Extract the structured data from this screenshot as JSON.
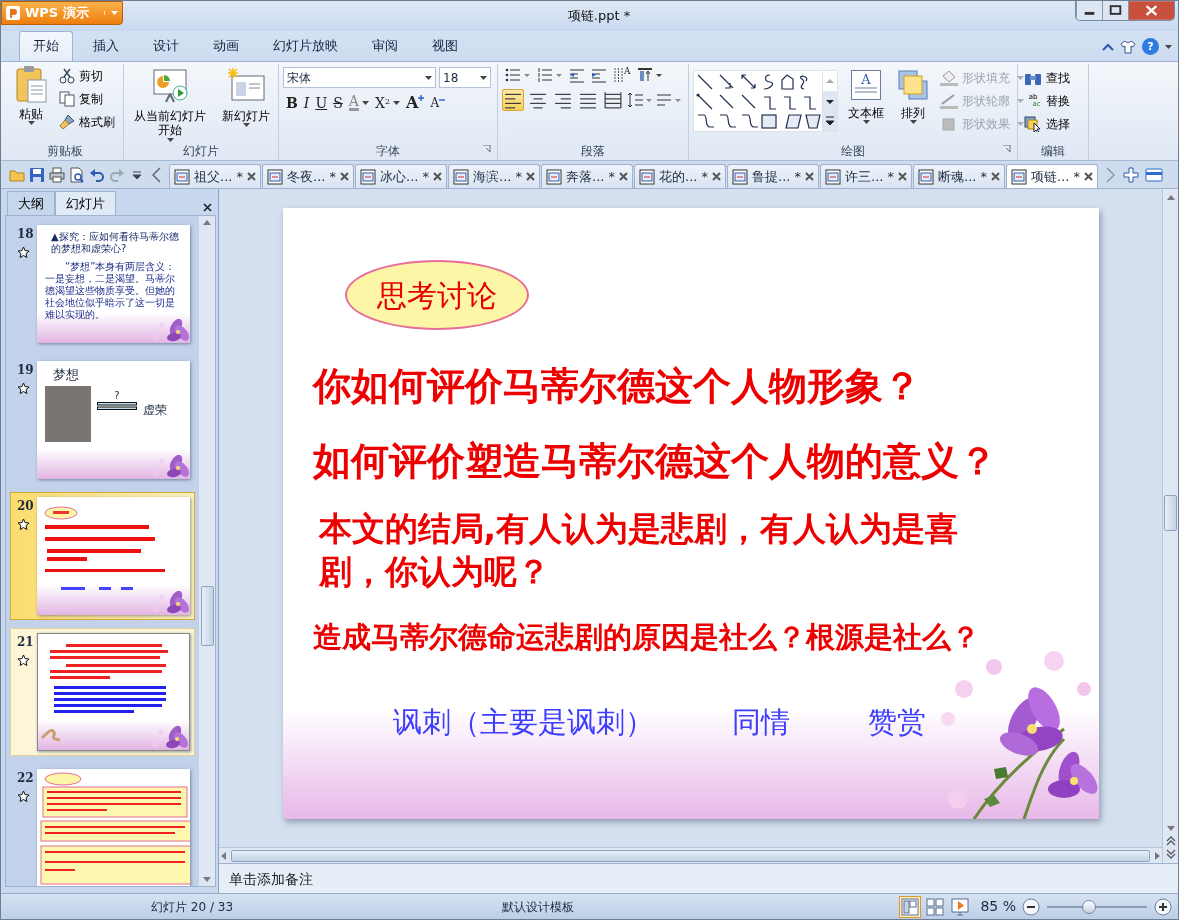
{
  "window": {
    "app_button": "WPS 演示",
    "title": "项链.ppt *"
  },
  "ribbon_tabs": [
    {
      "label": "开始",
      "selected": true
    },
    {
      "label": "插入",
      "selected": false
    },
    {
      "label": "设计",
      "selected": false
    },
    {
      "label": "动画",
      "selected": false
    },
    {
      "label": "幻灯片放映",
      "selected": false
    },
    {
      "label": "审阅",
      "selected": false
    },
    {
      "label": "视图",
      "selected": false
    }
  ],
  "ribbon_groups": [
    {
      "kind": "clipboard",
      "label": "剪贴板",
      "large": "粘贴",
      "small": [
        "剪切",
        "复制",
        "格式刷"
      ]
    },
    {
      "kind": "slides",
      "label": "幻灯片",
      "buttons": [
        {
          "lines": [
            "从当前幻灯片",
            "开始"
          ]
        },
        {
          "lines": [
            "新幻灯片"
          ]
        }
      ]
    },
    {
      "kind": "font",
      "label": "字体",
      "font": "宋体",
      "size": "18",
      "styles": [
        "B",
        "I",
        "U",
        "S"
      ],
      "font_color_glyph": "A",
      "superscript": "X$^{2}$",
      "grow": "A",
      "shrink": "A"
    },
    {
      "kind": "paragraph",
      "label": "段落",
      "direction": "A",
      "align": [
        {
          "selected": true
        },
        {
          "selected": false
        },
        {
          "selected": false
        },
        {
          "selected": false
        },
        {
          "selected": false
        }
      ]
    },
    {
      "kind": "drawing",
      "label": "绘图",
      "textbox_glyph": "A",
      "large": [
        "文本框",
        "排列"
      ],
      "shape_commands": [
        {
          "label": "形状填充",
          "disabled": true
        },
        {
          "label": "形状轮廓",
          "disabled": true
        },
        {
          "label": "形状效果",
          "disabled": true
        }
      ]
    },
    {
      "kind": "editing",
      "label": "编辑",
      "replace_glyphs": [
        "ab",
        "ac"
      ],
      "commands": [
        "查找",
        "替换",
        "选择"
      ]
    }
  ],
  "help": "?",
  "doc_tabs": [
    {
      "label": "祖父... *",
      "selected": false
    },
    {
      "label": "冬夜... *",
      "selected": false
    },
    {
      "label": "冰心... *",
      "selected": false
    },
    {
      "label": "海滨... *",
      "selected": false
    },
    {
      "label": "奔落... *",
      "selected": false
    },
    {
      "label": "花的... *",
      "selected": false
    },
    {
      "label": "鲁提... *",
      "selected": false
    },
    {
      "label": "许三... *",
      "selected": false
    },
    {
      "label": "断魂... *",
      "selected": false
    },
    {
      "label": "项链... *",
      "selected": true
    }
  ],
  "panel": {
    "tabs": [
      {
        "label": "大纲",
        "selected": false
      },
      {
        "label": "幻灯片",
        "selected": true
      }
    ],
    "thumbnails": [
      {
        "number": "18",
        "kind": "text",
        "selected": false,
        "hovered": false,
        "title": "▲探究：应如何看待马蒂尔德的梦想和虚荣心?",
        "body": "“梦想”本身有两层含义：一是妄想，二是渴望。马蒂尔德渴望这些物质享受。但她的社会地位似乎暗示了这一切是难以实现的。"
      },
      {
        "number": "19",
        "kind": "image",
        "selected": false,
        "hovered": false,
        "heading": "梦想",
        "mark": "?",
        "label": "虚荣"
      },
      {
        "number": "20",
        "kind": "questions",
        "selected": true,
        "hovered": false
      },
      {
        "number": "21",
        "kind": "paragraphs",
        "selected": false,
        "hovered": true
      },
      {
        "number": "22",
        "kind": "boxes",
        "selected": false,
        "hovered": false
      }
    ]
  },
  "slide": {
    "badge": "思考讨论",
    "questions": [
      "你如何评价马蒂尔德这个人物形象？",
      "如何评价塑造马蒂尔德这个人物的意义？",
      "本文的结局,有人认为是悲剧，有人认为是喜剧，你认为呢？",
      "造成马蒂尔德命运悲剧的原因是社么？根源是社么？"
    ],
    "answers": [
      "讽刺（主要是讽刺）",
      "同情",
      "赞赏"
    ]
  },
  "notes": {
    "placeholder": "单击添加备注"
  },
  "status_bar": {
    "slide_counter": "幻灯片 20 / 33",
    "template": "默认设计模板",
    "views": [
      {
        "selected": true
      },
      {
        "selected": false
      },
      {
        "selected": false
      }
    ],
    "zoom": "85 %",
    "zoom_slider": {
      "level": 0.42
    }
  }
}
